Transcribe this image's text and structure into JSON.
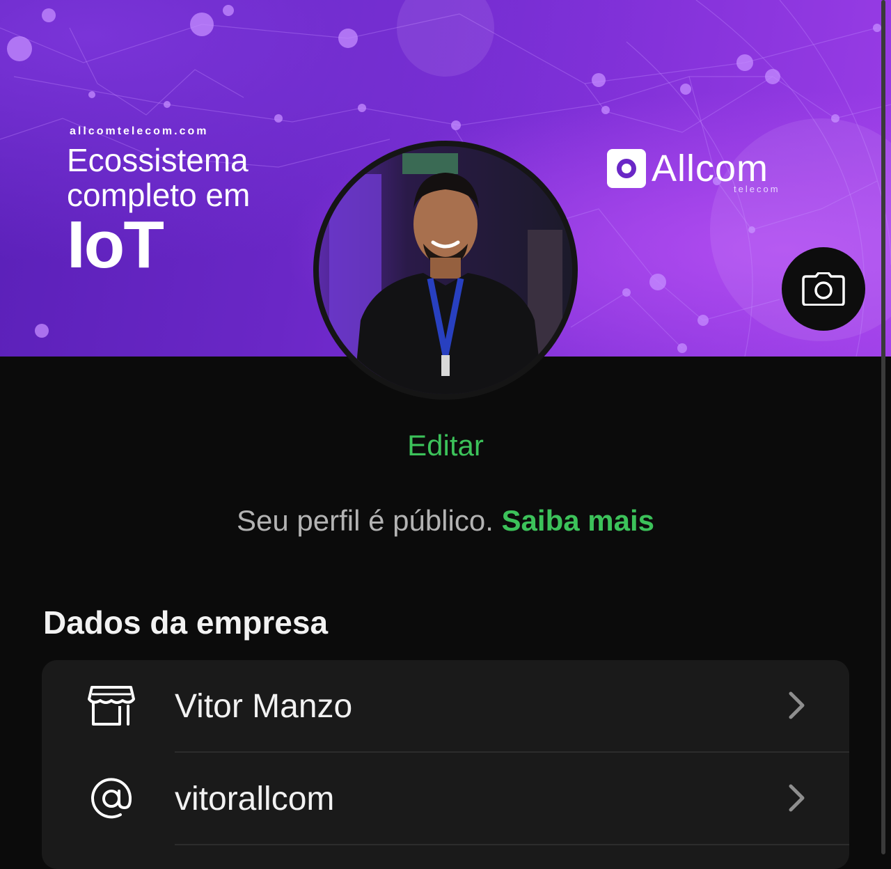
{
  "cover": {
    "site": "allcomtelecom.com",
    "line1": "Ecossistema",
    "line2": "completo em",
    "big": "IoT",
    "brand_name": "Allcom",
    "brand_sub": "telecom"
  },
  "camera_icon": "camera-icon",
  "profile": {
    "edit_label": "Editar",
    "public_text": "Seu perfil é público.",
    "learn_more": "Saiba mais"
  },
  "section": {
    "title": "Dados da empresa",
    "rows": [
      {
        "icon": "storefront-icon",
        "label": "Vitor Manzo"
      },
      {
        "icon": "at-sign-icon",
        "label": "vitorallcom"
      }
    ]
  },
  "colors": {
    "accent_green": "#3cc25a",
    "background": "#0b0b0b",
    "card": "#1a1a1a",
    "cover_purple": "#6a27c6"
  }
}
